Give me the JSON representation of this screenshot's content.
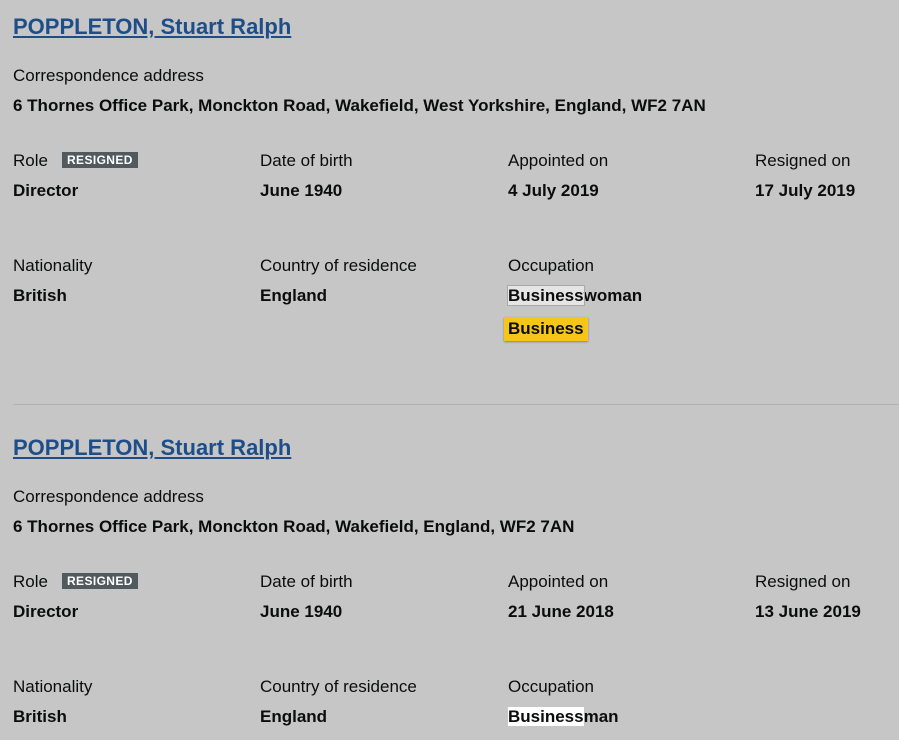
{
  "officers": [
    {
      "name": "POPPLETON, Stuart Ralph",
      "address_label": "Correspondence address",
      "address": "6 Thornes Office Park, Monckton Road, Wakefield, West Yorkshire, England, WF2 7AN",
      "role_label": "Role",
      "status_badge": "RESIGNED",
      "role": "Director",
      "dob_label": "Date of birth",
      "dob": "June 1940",
      "appointed_label": "Appointed on",
      "appointed": "4 July 2019",
      "resigned_label": "Resigned on",
      "resigned": "17 July 2019",
      "nationality_label": "Nationality",
      "nationality": "British",
      "residence_label": "Country of residence",
      "residence": "England",
      "occupation_label": "Occupation",
      "occupation_match": "Business",
      "occupation_rest": "woman",
      "search_highlight": "Business"
    },
    {
      "name": "POPPLETON, Stuart Ralph",
      "address_label": "Correspondence address",
      "address": "6 Thornes Office Park, Monckton Road, Wakefield, England, WF2 7AN",
      "role_label": "Role",
      "status_badge": "RESIGNED",
      "role": "Director",
      "dob_label": "Date of birth",
      "dob": "June 1940",
      "appointed_label": "Appointed on",
      "appointed": "21 June 2018",
      "resigned_label": "Resigned on",
      "resigned": "13 June 2019",
      "nationality_label": "Nationality",
      "nationality": "British",
      "residence_label": "Country of residence",
      "residence": "England",
      "occupation_label": "Occupation",
      "occupation_match": "Business",
      "occupation_rest": "man"
    }
  ],
  "colors": {
    "background": "#c6c6c6",
    "link": "#1d4e89",
    "badge": "#505a5f",
    "highlight_active": "#f5c518"
  }
}
